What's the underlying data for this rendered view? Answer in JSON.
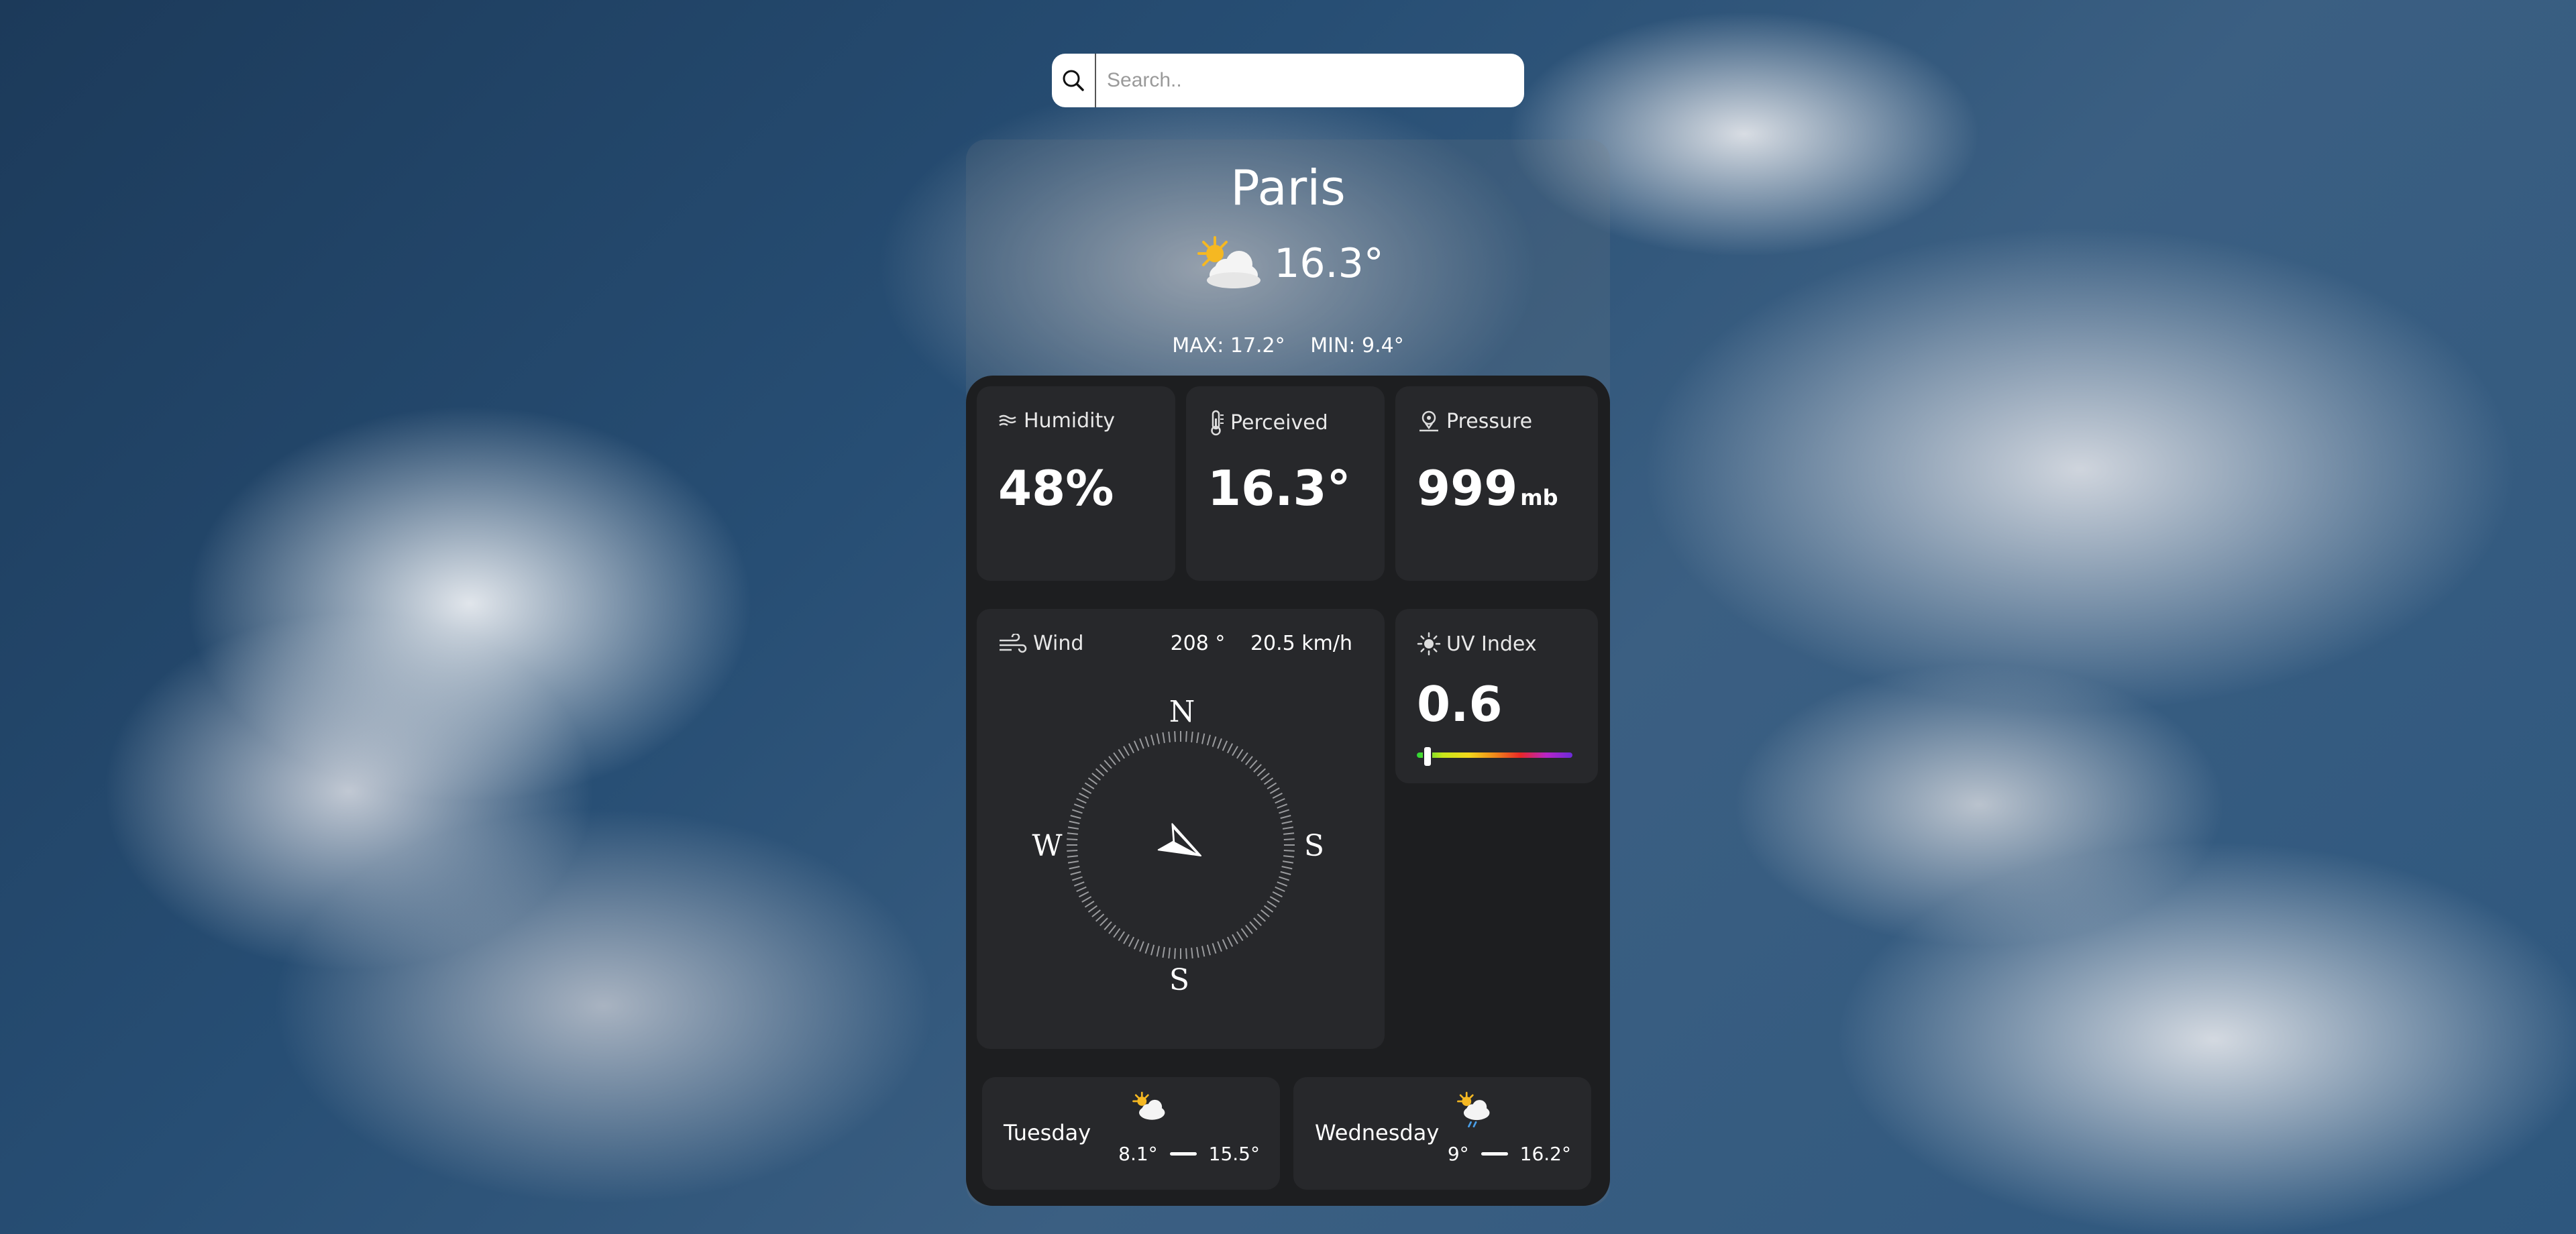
{
  "search": {
    "placeholder": "Search.."
  },
  "city": "Paris",
  "current": {
    "temperature": "16.3°",
    "condition_icon": "partly-cloudy-icon"
  },
  "minmax": {
    "max": "MAX: 17.2°",
    "min": "MIN: 9.4°"
  },
  "humidity": {
    "label": "Humidity",
    "value": "48%"
  },
  "perceived": {
    "label": "Perceived",
    "value": "16.3°"
  },
  "pressure": {
    "label": "Pressure",
    "value": "999",
    "unit": "mb"
  },
  "wind": {
    "label": "Wind",
    "direction": "208 °",
    "speed": "20.5 km/h",
    "direction_degrees": 208,
    "compass": {
      "north": "N",
      "west": "W",
      "east": "S",
      "south": "S"
    }
  },
  "uv": {
    "label": "UV Index",
    "value": "0.6",
    "level_fraction": 0.06
  },
  "forecast": [
    {
      "day": "Tuesday",
      "low": "8.1°",
      "high": "15.5°",
      "icon": "partly-cloudy-icon"
    },
    {
      "day": "Wednesday",
      "low": "9°",
      "high": "16.2°",
      "icon": "rain-cloud-icon"
    }
  ]
}
